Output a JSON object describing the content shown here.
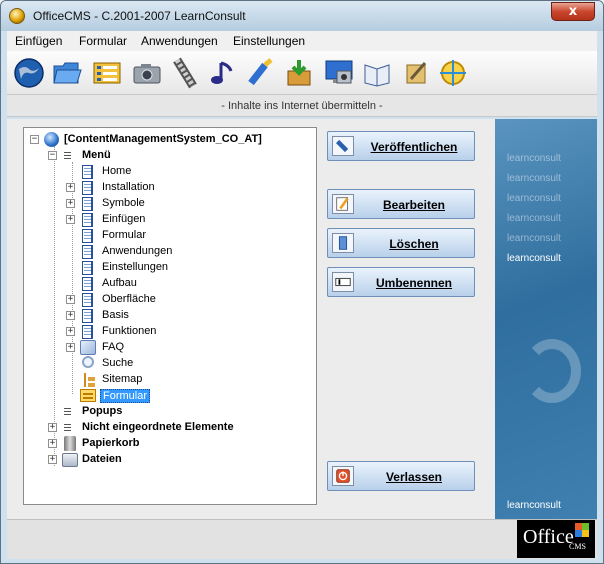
{
  "window": {
    "title": "OfficeCMS - C.2001-2007 LearnConsult",
    "close_glyph": "x"
  },
  "menu": [
    "Einfügen",
    "Formular",
    "Anwendungen",
    "Einstellungen"
  ],
  "toolbar": {
    "icons": [
      "globe-icon",
      "folder-icon",
      "list-icon",
      "camera-icon",
      "film-icon",
      "music-note-icon",
      "brush-icon",
      "download-box-icon",
      "screen-photo-icon",
      "book-icon",
      "tools-icon",
      "crosshair-icon"
    ]
  },
  "info_strip": "- Inhalte ins Internet übermitteln -",
  "tree": {
    "root": "[ContentManagementSystem_CO_AT]",
    "menu_label": "Menü",
    "menu_children": [
      {
        "label": "Home",
        "expander": false,
        "icon": "page"
      },
      {
        "label": "Installation",
        "expander": true,
        "icon": "page"
      },
      {
        "label": "Symbole",
        "expander": true,
        "icon": "page"
      },
      {
        "label": "Einfügen",
        "expander": true,
        "icon": "page"
      },
      {
        "label": "Formular",
        "expander": false,
        "icon": "page"
      },
      {
        "label": "Anwendungen",
        "expander": false,
        "icon": "page"
      },
      {
        "label": "Einstellungen",
        "expander": false,
        "icon": "page"
      },
      {
        "label": "Aufbau",
        "expander": false,
        "icon": "page"
      },
      {
        "label": "Oberfläche",
        "expander": true,
        "icon": "page"
      },
      {
        "label": "Basis",
        "expander": true,
        "icon": "page"
      },
      {
        "label": "Funktionen",
        "expander": true,
        "icon": "page"
      },
      {
        "label": "FAQ",
        "expander": true,
        "icon": "faq"
      },
      {
        "label": "Suche",
        "expander": false,
        "icon": "search"
      },
      {
        "label": "Sitemap",
        "expander": false,
        "icon": "sitemap"
      },
      {
        "label": "Formular",
        "expander": false,
        "icon": "form",
        "selected": true
      }
    ],
    "popups": "Popups",
    "unsorted": "Nicht eingeordnete Elemente",
    "trash": "Papierkorb",
    "files": "Dateien"
  },
  "actions": {
    "publish": "Veröffentlichen",
    "edit": "Bearbeiten",
    "delete": "Löschen",
    "rename": "Umbenennen",
    "exit": "Verlassen"
  },
  "brand": {
    "lines": [
      "learnconsult",
      "learnconsult",
      "learnconsult",
      "learnconsult",
      "learnconsult",
      "learnconsult"
    ],
    "footer": "learnconsult",
    "logo_main": "Office",
    "logo_sub": "CMS",
    "panel_color": "#3a78a8"
  }
}
